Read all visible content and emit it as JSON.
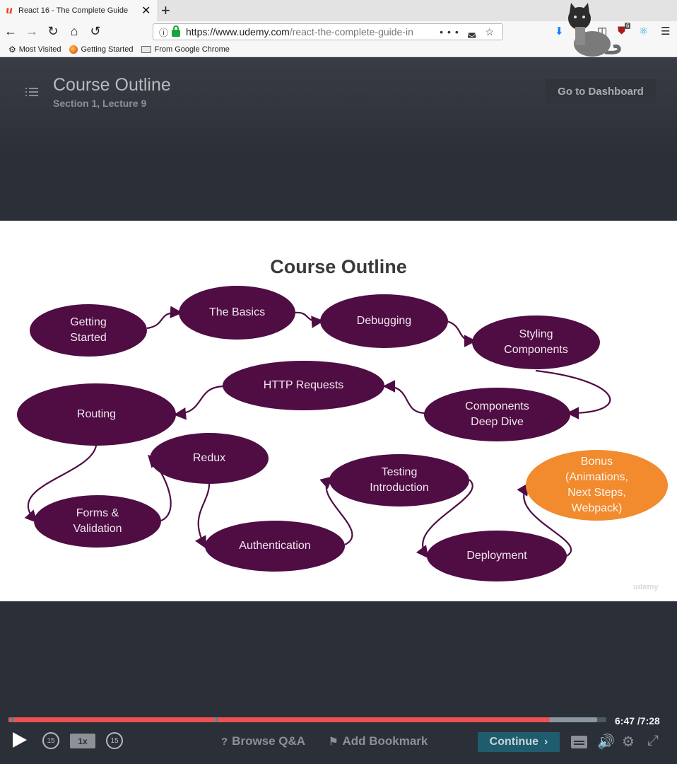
{
  "browser": {
    "tab_title": "React 16 - The Complete Guide",
    "tab_close": "✕",
    "new_tab": "+",
    "url_domain": "https://www.udemy.com",
    "url_path": "/react-the-complete-guide-in",
    "page_actions": "•••",
    "extension_badge": "6",
    "bookmarks": [
      "Most Visited",
      "Getting Started",
      "From Google Chrome"
    ]
  },
  "header": {
    "title": "Course Outline",
    "subtitle": "Section 1, Lecture 9",
    "dashboard_button": "Go to Dashboard"
  },
  "slide": {
    "title": "Course Outline",
    "watermark": "udemy",
    "nodes": [
      {
        "id": "getting-started",
        "label": "Getting\nStarted"
      },
      {
        "id": "the-basics",
        "label": "The Basics"
      },
      {
        "id": "debugging",
        "label": "Debugging"
      },
      {
        "id": "styling-components",
        "label": "Styling\nComponents"
      },
      {
        "id": "components-deep-dive",
        "label": "Components\nDeep Dive"
      },
      {
        "id": "http-requests",
        "label": "HTTP Requests"
      },
      {
        "id": "routing",
        "label": "Routing"
      },
      {
        "id": "forms-validation",
        "label": "Forms &\nValidation"
      },
      {
        "id": "redux",
        "label": "Redux"
      },
      {
        "id": "authentication",
        "label": "Authentication"
      },
      {
        "id": "testing-introduction",
        "label": "Testing\nIntroduction"
      },
      {
        "id": "deployment",
        "label": "Deployment"
      },
      {
        "id": "bonus",
        "label": "Bonus\n(Animations,\nNext Steps,\nWebpack)"
      }
    ]
  },
  "player": {
    "current_time": "6:47",
    "total_time": "/7:28",
    "played_fraction": 0.905,
    "buffered_fraction": 0.985,
    "skip_back": "15",
    "skip_forward": "15",
    "speed": "1x",
    "browse_qa": "Browse Q&A",
    "add_bookmark": "Add Bookmark",
    "continue": "Continue",
    "colors": {
      "played": "#ec5252",
      "buffered": "#8a96a1",
      "accent": "#1f5c6d"
    }
  }
}
